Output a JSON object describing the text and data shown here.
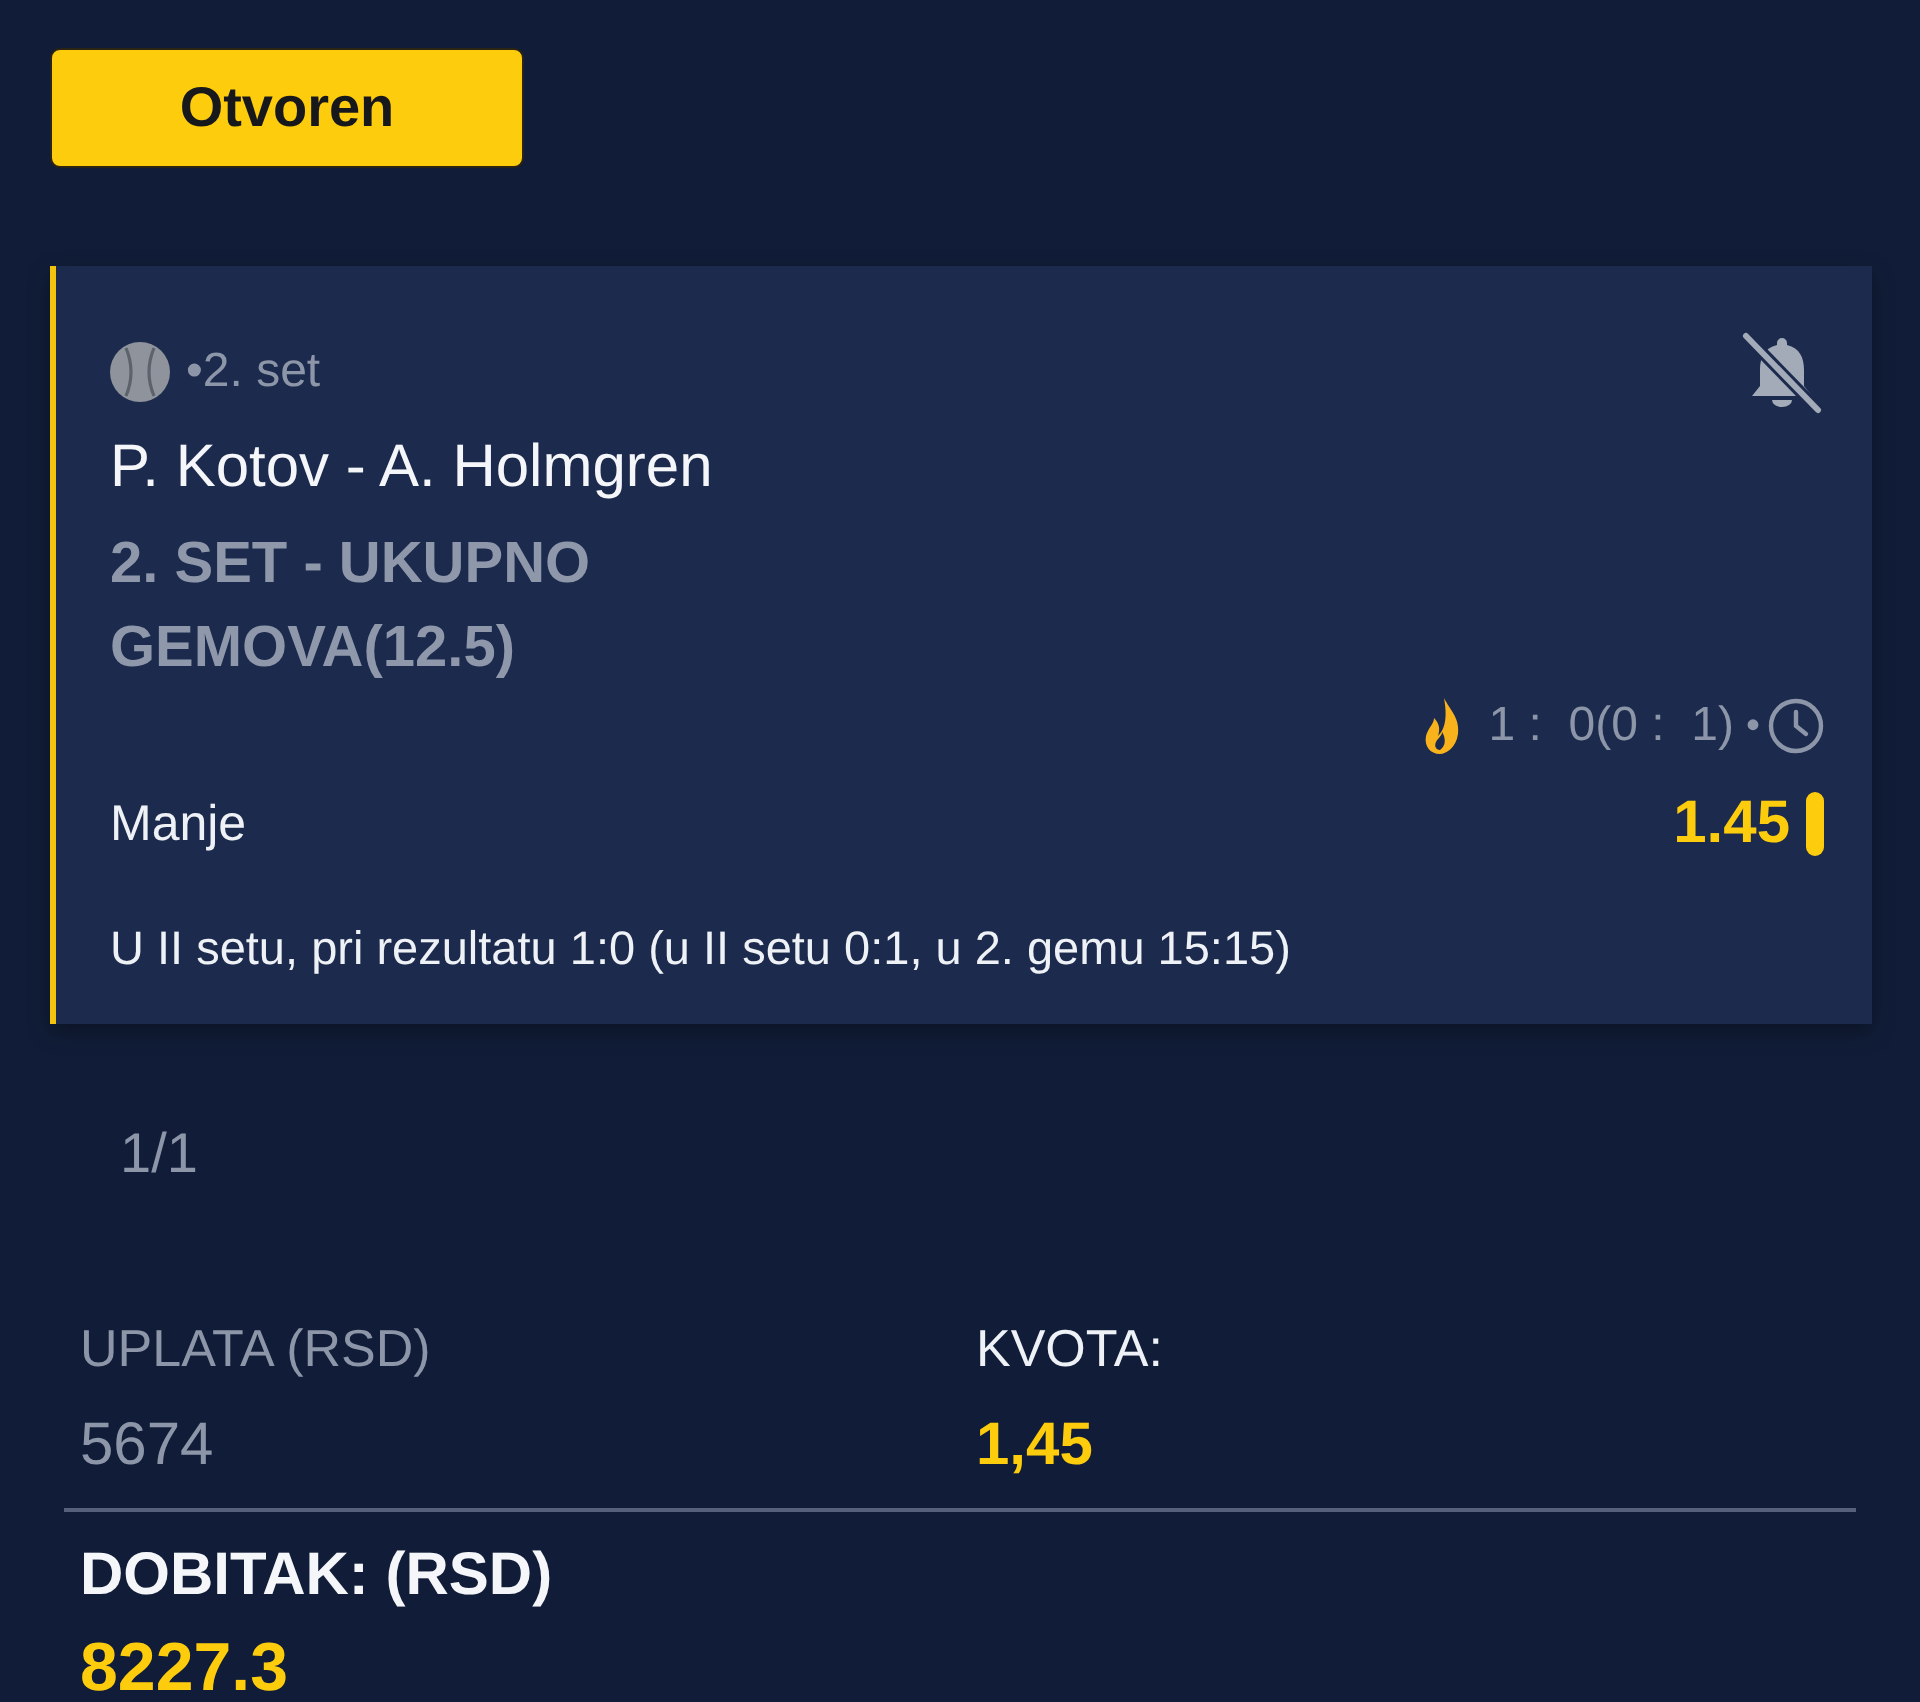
{
  "status_badge": {
    "label": "Otvoren"
  },
  "bet": {
    "period": "•2. set",
    "notifications_off": true,
    "match": "P. Kotov - A. Holmgren",
    "market": "2. SET - UKUPNO GEMOVA(12.5)",
    "score": "1 :  0(0 :  1)",
    "separator": "•",
    "selection": "Manje",
    "odds": "1.45",
    "description": "U II setu, pri rezultatu 1:0 (u II setu 0:1, u 2. gemu 15:15)"
  },
  "pagination": "1/1",
  "summary": {
    "stake_label": "UPLATA (RSD)",
    "stake": "5674",
    "odds_label": "KVOTA:",
    "odds": "1,45",
    "payout_label": "DOBITAK: (RSD)",
    "payout": "8227.3"
  }
}
